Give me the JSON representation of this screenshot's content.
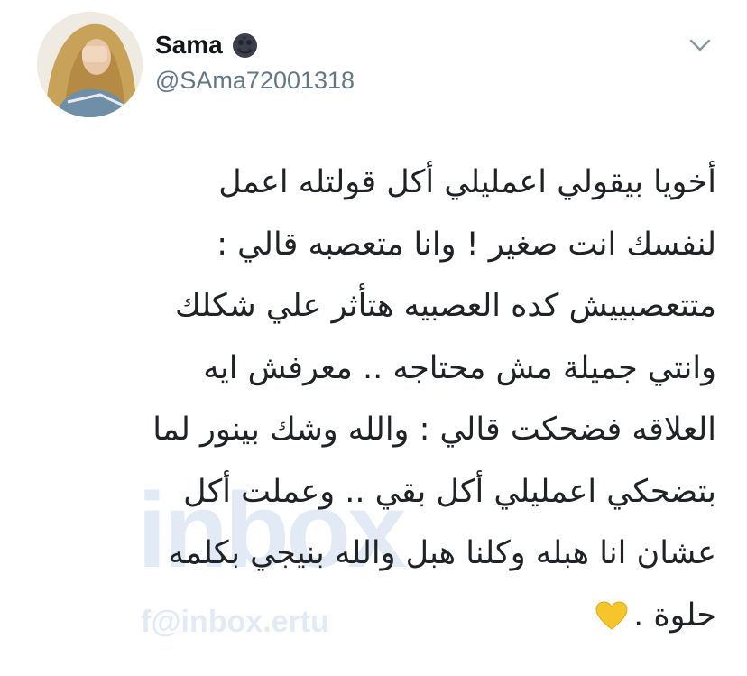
{
  "user": {
    "display_name": "Sama",
    "handle": "@SAma72001318",
    "name_emoji_icon": "new-moon-face-emoji-icon",
    "avatar_icon": "profile-photo-avatar"
  },
  "menu": {
    "icon": "chevron-down-icon"
  },
  "tweet": {
    "lines": [
      "أخويا بيقولي اعمليلي أكل قولتله اعمل",
      "لنفسك انت صغير ! وانا متعصبه قالي :",
      "متتعصبييش كده العصبيه هتأثر علي شكلك",
      "وانتي جميلة مش محتاجه .. معرفش ايه",
      "العلاقه فضحكت قالي : والله وشك بينور لما",
      "بتضحكي اعمليلي أكل بقي .. وعملت أكل",
      "عشان انا هبله وكلنا هبل والله بنيجي بكلمه",
      "حلوة ."
    ],
    "end_emoji_icon": "yellow-heart-icon",
    "colors": {
      "text": "#1f2326",
      "heart": "#f5c52b"
    }
  },
  "watermark": {
    "big_text": "inbox",
    "small_text": "f@inbox.ertu"
  }
}
